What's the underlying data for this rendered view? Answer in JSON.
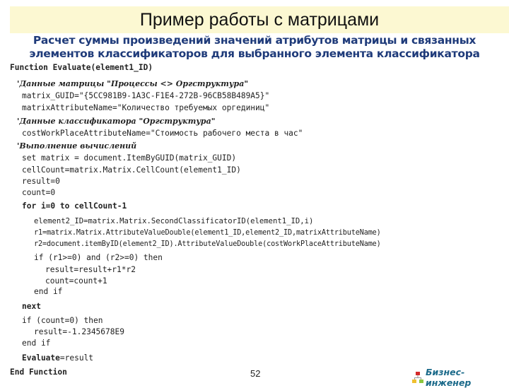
{
  "slide": {
    "title": "Пример работы с матрицами",
    "subtitle_line1": "Расчет суммы произведений значений атрибутов матрицы и связанных",
    "subtitle_line2": "элементов классификаторов для выбранного элемента классификатора",
    "page_number": "52",
    "brand": "Бизнес-инженер",
    "brand_icon": "org-chart-icon",
    "colors": {
      "title_bg": "#fcf8d2",
      "subtitle": "#1f3b7a",
      "brand": "#1b6a8a"
    }
  },
  "code": {
    "l01": "Function Evaluate(element1_ID)",
    "l02": "'Данные матрицы \"Процессы <> Оргструктура\"",
    "l03": "matrix_GUID=\"{5CC981B9-1A3C-F1E4-272B-96CB58B489A5}\"",
    "l04": "matrixAttributeName=\"Количество требуемых оргединиц\"",
    "l05": "'Данные классификатора \"Оргструктура\"",
    "l06": "costWorkPlaceAttributeName=\"Стоимость рабочего места в час\"",
    "l07": "'Выполнение вычислений",
    "l08": "set matrix = document.ItemByGUID(matrix_GUID)",
    "l09": "cellCount=matrix.Matrix.CellCount(element1_ID)",
    "l10": "result=0",
    "l11": "count=0",
    "l12": "for i=0 to cellCount-1",
    "l13": "element2_ID=matrix.Matrix.SecondClassificatorID(element1_ID,i)",
    "l14": "r1=matrix.Matrix.AttributeValueDouble(element1_ID,element2_ID,matrixAttributeName)",
    "l15": "r2=document.itemByID(element2_ID).AttributeValueDouble(costWorkPlaceAttributeName)",
    "l16": "if (r1>=0) and (r2>=0) then",
    "l17": "result=result+r1*r2",
    "l18": "count=count+1",
    "l19": "end if",
    "l20": "next",
    "l21": "if (count=0) then",
    "l22": "result=-1.2345678E9",
    "l23": "end if",
    "l24a": "Evaluate",
    "l24b": "=result",
    "l25": "End Function"
  }
}
